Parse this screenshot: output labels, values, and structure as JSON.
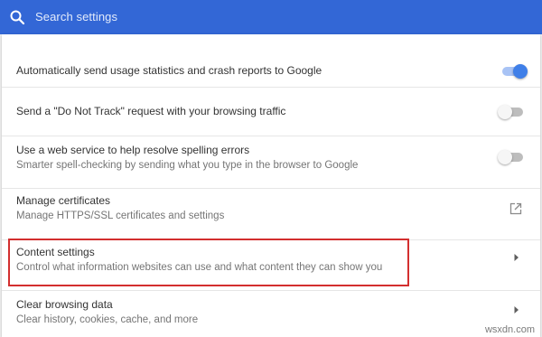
{
  "search": {
    "placeholder": "Search settings"
  },
  "rows": [
    {
      "label": "Automatically send usage statistics and crash reports to Google",
      "toggle": "on"
    },
    {
      "label": "Send a \"Do Not Track\" request with your browsing traffic",
      "toggle": "off"
    },
    {
      "label": "Use a web service to help resolve spelling errors",
      "sublabel": "Smarter spell-checking by sending what you type in the browser to Google",
      "toggle": "off"
    },
    {
      "label": "Manage certificates",
      "sublabel": "Manage HTTPS/SSL certificates and settings",
      "action": "open-in-new-icon"
    },
    {
      "label": "Content settings",
      "sublabel": "Control what information websites can use and what content they can show you",
      "action": "chevron-right-icon",
      "highlighted": true
    },
    {
      "label": "Clear browsing data",
      "sublabel": "Clear history, cookies, cache, and more",
      "action": "chevron-right-icon"
    }
  ],
  "watermark": "wsxdn.com",
  "colors": {
    "header": "#3367d6",
    "toggle_on": "#3f7fe8",
    "highlight_border": "#d32f2f"
  }
}
